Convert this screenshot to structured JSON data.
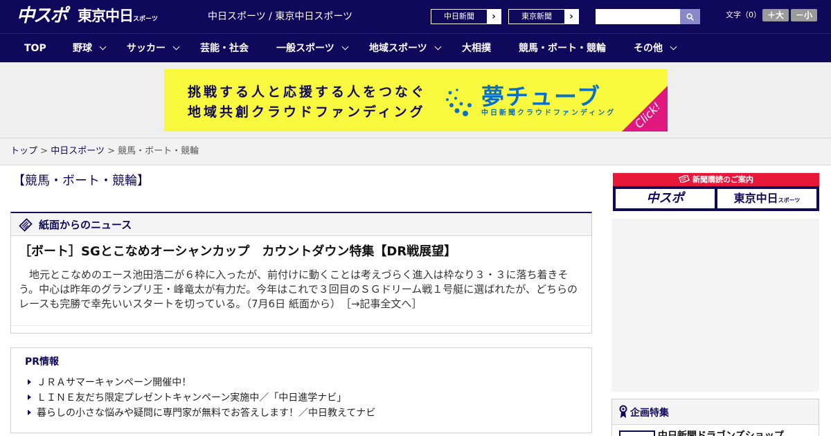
{
  "header": {
    "logo_chuspo": "中スポ",
    "logo_tokyo_main": "東京中日",
    "logo_tokyo_small": "スポーツ",
    "site_title": "中日スポーツ / 東京中日スポーツ",
    "paper_links": [
      {
        "label": "中日新聞",
        "arrow": "›"
      },
      {
        "label": "東京新聞",
        "arrow": "›"
      }
    ],
    "search": {
      "placeholder": "",
      "value": ""
    },
    "font_size": {
      "label": "文字（0）",
      "bigger": "＋大",
      "smaller": "－小"
    }
  },
  "nav": {
    "items": [
      {
        "label": "TOP",
        "has_dropdown": false
      },
      {
        "label": "野球",
        "has_dropdown": true
      },
      {
        "label": "サッカー",
        "has_dropdown": true
      },
      {
        "label": "芸能・社会",
        "has_dropdown": false
      },
      {
        "label": "一般スポーツ",
        "has_dropdown": true
      },
      {
        "label": "地域スポーツ",
        "has_dropdown": true
      },
      {
        "label": "大相撲",
        "has_dropdown": false
      },
      {
        "label": "競馬・ボート・競輪",
        "has_dropdown": false
      },
      {
        "label": "その他",
        "has_dropdown": true
      }
    ]
  },
  "ad_banner": {
    "line1": "挑戦する人と応援する人をつなぐ",
    "line2": "地域共創クラウドファンディング",
    "brand": "夢チューブ",
    "brand_sub": "中日新聞クラウドファンディング",
    "click": "Click!"
  },
  "breadcrumb": {
    "items": [
      "トップ",
      "中日スポーツ"
    ],
    "separator": ">",
    "current": "競馬・ボート・競輪"
  },
  "main": {
    "page_title": "【競馬・ボート・競輪】",
    "news_section": {
      "heading": "紙面からのニュース",
      "article": {
        "title": "［ボート］SGとこなめオーシャンカップ　カウントダウン特集【DR戦展望】",
        "body": "　地元とこなめのエース池田浩二が６枠に入ったが、前付けに動くことは考えづらく進入は枠なり３・３に落ち着きそう。中心は昨年のグランプリ王・峰竜太が有力だ。今年はこれで３回目のＳＧドリーム戦１号艇に選ばれたが、どちらのレースも完勝で幸先いいスタートを切っている。（7月6日 紙面から）　",
        "more_link": "［→記事全文へ］"
      }
    },
    "pr_section": {
      "heading": "PR情報",
      "items": [
        "ＪＲＡサマーキャンペーン開催中！",
        "ＬＩＮＥ友だち限定プレゼントキャンペーン実施中／「中日進学ナビ」",
        "暮らしの小さな悩みや疑問に専門家が無料でお答えします！／中日教えてナビ"
      ]
    }
  },
  "sidebar": {
    "subscription": {
      "heading": "新聞購読のご案内",
      "buttons": [
        "中スポ",
        "東京中日"
      ],
      "button_small": "スポーツ"
    },
    "kikaku": {
      "heading": "企画特集",
      "first_item": "中日新聞ドラゴンズショップ"
    }
  },
  "colors": {
    "navy": "#10085a",
    "banner_yellow": "#f8f83e",
    "brand_blue": "#0a6fc6",
    "click_pink": "#e0177e",
    "subscribe_red": "#e8183a"
  }
}
